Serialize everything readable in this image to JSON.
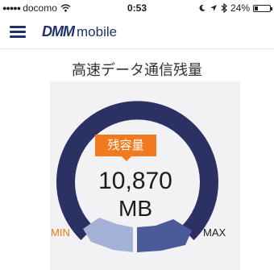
{
  "status_bar": {
    "signal": "●●●●●",
    "carrier": "docomo",
    "time": "0:53",
    "battery_text": "24%",
    "battery_level": 0.24
  },
  "header": {
    "brand": "DMM",
    "brand_sub": "mobile"
  },
  "main": {
    "title": "高速データ通信残量",
    "badge": "残容量",
    "value": "10,870",
    "unit": "MB",
    "min_label": "MIN",
    "max_label": "MAX"
  },
  "gauge": {
    "track_color": "#2b3163",
    "low_color": "#a4b2d8",
    "mid_color": "#4a5b9a",
    "accent_color": "#f07a1d"
  }
}
